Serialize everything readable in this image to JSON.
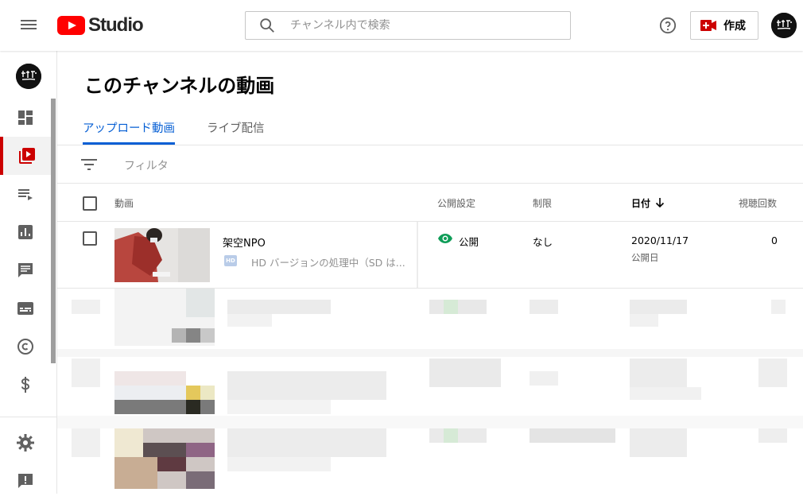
{
  "app": {
    "logo_text": "Studio"
  },
  "search": {
    "placeholder": "チャンネル内で検索"
  },
  "header": {
    "create_label": "作成",
    "help_icon": "help-circle-icon"
  },
  "page": {
    "title": "このチャンネルの動画"
  },
  "tabs": [
    {
      "label": "アップロード動画",
      "active": true
    },
    {
      "label": "ライブ配信",
      "active": false
    }
  ],
  "filter": {
    "placeholder": "フィルタ"
  },
  "table": {
    "columns": {
      "video": "動画",
      "visibility": "公開設定",
      "restrictions": "制限",
      "date": "日付",
      "views": "視聴回数"
    },
    "rows": [
      {
        "title": "架空NPO",
        "hd_badge": "HD",
        "status": "HD バージョンの処理中（SD は...",
        "visibility": "公開",
        "restrictions": "なし",
        "date": "2020/11/17",
        "date_sub": "公開日",
        "views": "0"
      }
    ]
  },
  "sidebar": {
    "items": [
      {
        "icon": "dashboard-icon",
        "active": false
      },
      {
        "icon": "videos-icon",
        "active": true
      },
      {
        "icon": "playlists-icon",
        "active": false
      },
      {
        "icon": "analytics-icon",
        "active": false
      },
      {
        "icon": "comments-icon",
        "active": false
      },
      {
        "icon": "subtitles-icon",
        "active": false
      },
      {
        "icon": "copyright-icon",
        "active": false
      },
      {
        "icon": "monetization-icon",
        "active": false
      },
      {
        "icon": "settings-icon",
        "active": false
      },
      {
        "icon": "feedback-icon",
        "active": false
      }
    ]
  },
  "colors": {
    "accent_blue": "#065fd4",
    "brand_red": "#ff0000",
    "active_red": "#cc0000",
    "visible_green": "#0f9d58"
  }
}
